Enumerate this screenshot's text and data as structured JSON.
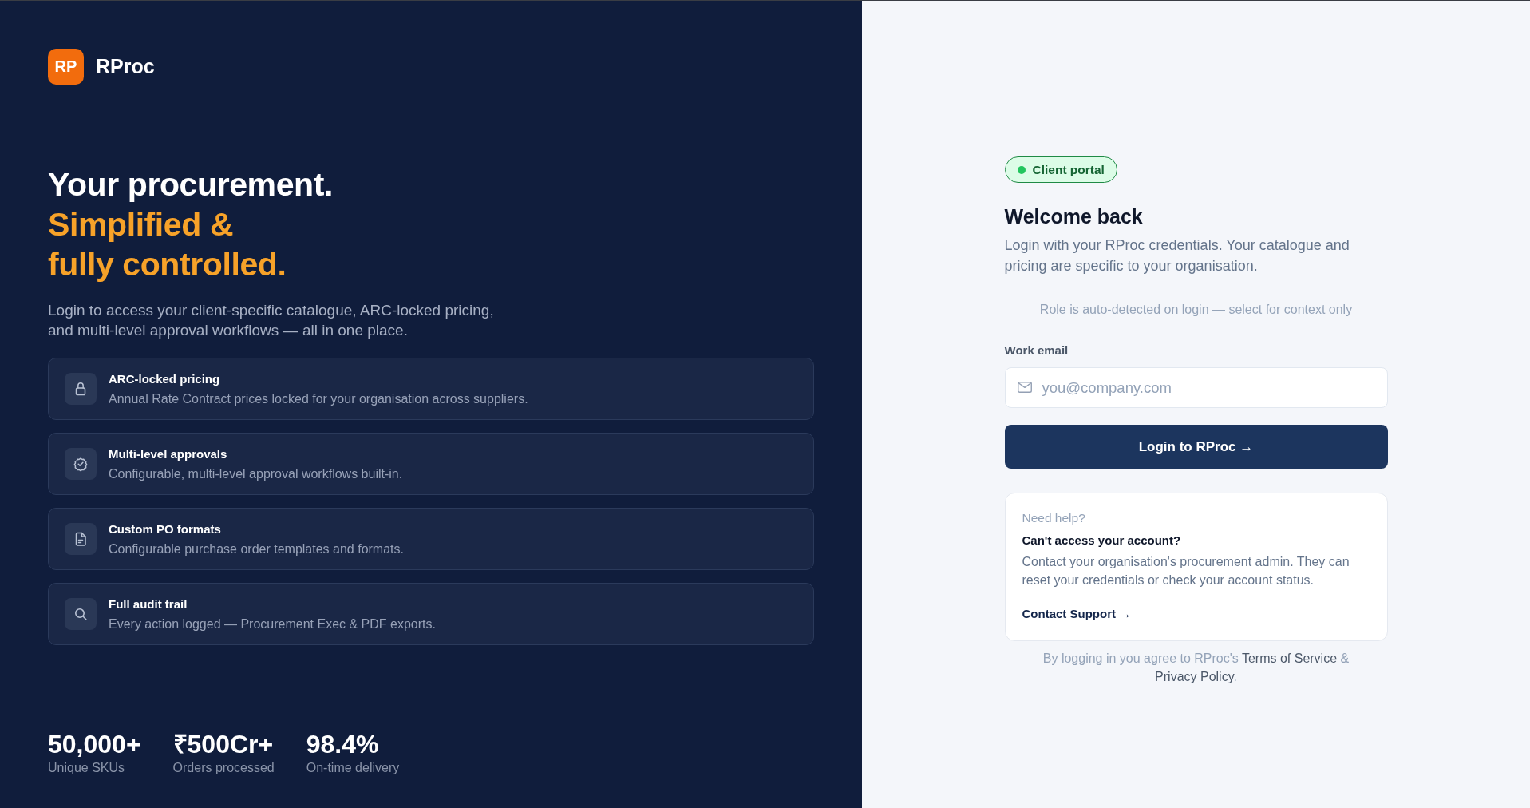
{
  "brand": {
    "initials": "RP",
    "name": "RProc"
  },
  "hero": {
    "headline": "Your procurement.",
    "highlight_lines": [
      "Simplified &",
      "fully controlled."
    ],
    "description": "Login to access your client-specific catalogue, ARC-locked pricing, and multi-level approval workflows — all in one place."
  },
  "features": [
    {
      "kind": "pricing",
      "title": "ARC-locked pricing",
      "description": "Annual Rate Contract prices locked for your organisation across suppliers."
    },
    {
      "kind": "approvals",
      "title": "Multi-level approvals",
      "description": "Configurable, multi-level approval workflows built-in."
    },
    {
      "kind": "formats",
      "title": "Custom PO formats",
      "description": "Configurable purchase order templates and formats."
    },
    {
      "kind": "audit",
      "title": "Full audit trail",
      "description": "Every action logged — Procurement Exec & PDF exports."
    }
  ],
  "stats": [
    {
      "value": "50,000+",
      "label": "Unique SKUs"
    },
    {
      "value": "₹500Cr+",
      "label": "Orders processed"
    },
    {
      "value": "98.4%",
      "label": "On-time delivery"
    }
  ],
  "login": {
    "badge": "Client portal",
    "title": "Welcome back",
    "subtitle": "Login with your RProc credentials. Your catalogue and pricing are specific to your organisation.",
    "role_note": "Role is auto-detected on login — select for context only",
    "email": {
      "label": "Work email",
      "placeholder": "you@company.com"
    },
    "submit": "Login to RProc →"
  },
  "help": {
    "eyebrow": "Need help?",
    "title": "Can't access your account?",
    "body": "Contact your organisation's procurement admin. They can reset your credentials or check your account status.",
    "link": "Contact Support →"
  },
  "legal": {
    "prefix": "By logging in you agree to RProc's",
    "terms": "Terms of Service",
    "joiner": "&",
    "privacy": "Privacy Policy",
    "suffix": "."
  }
}
